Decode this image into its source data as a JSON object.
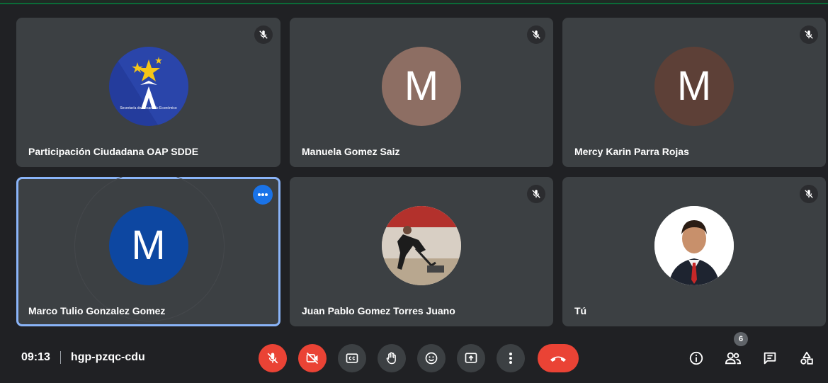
{
  "tiles": [
    {
      "name": "Participación Ciudadana OAP SDDE",
      "avatar": "",
      "logo_text": "Secretaría de Desarrollo Económico"
    },
    {
      "name": "Manuela Gomez Saiz",
      "avatar": "M",
      "avatar_color": "#8d6e63"
    },
    {
      "name": "Mercy Karin Parra Rojas",
      "avatar": "M",
      "avatar_color": "#5d4037"
    },
    {
      "name": "Marco Tulio Gonzalez Gomez",
      "avatar": "M",
      "avatar_color": "#0d47a1"
    },
    {
      "name": "Juan Pablo Gomez Torres Juano",
      "avatar": ""
    },
    {
      "name": "Tú",
      "avatar": ""
    }
  ],
  "meeting": {
    "time": "09:13",
    "code": "hgp-pzqc-cdu"
  },
  "participants_count": "6",
  "colors": {
    "background": "#202124",
    "tile": "#3c4043",
    "red": "#ea4335",
    "accent_blue": "#1a73e8",
    "active_outline": "#8ab4f8"
  },
  "icons": [
    "mic-off-icon",
    "camera-off-icon",
    "captions-icon",
    "raise-hand-icon",
    "emoji-icon",
    "present-icon",
    "more-options-icon",
    "end-call-icon",
    "info-icon",
    "people-icon",
    "chat-icon",
    "activities-icon"
  ]
}
